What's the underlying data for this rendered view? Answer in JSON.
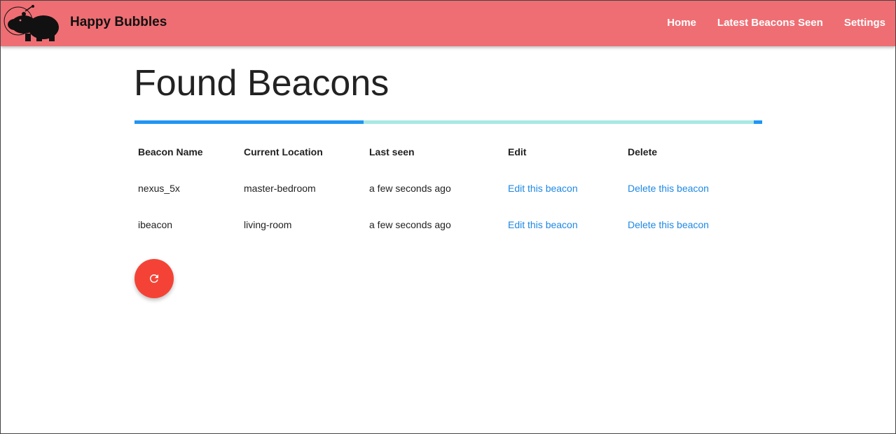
{
  "navbar": {
    "brand": "Happy Bubbles",
    "links": [
      {
        "label": "Home"
      },
      {
        "label": "Latest Beacons Seen"
      },
      {
        "label": "Settings"
      }
    ],
    "color": "#ef6e73"
  },
  "page": {
    "title": "Found Beacons"
  },
  "progress": {
    "fraction": 0.365,
    "bar_color": "#2196f3",
    "track_color": "#a7e8e4"
  },
  "table": {
    "headers": [
      "Beacon Name",
      "Current Location",
      "Last seen",
      "Edit",
      "Delete"
    ],
    "rows": [
      {
        "name": "nexus_5x",
        "location": "master-bedroom",
        "last_seen": "a few seconds ago",
        "edit": "Edit this beacon",
        "delete": "Delete this beacon"
      },
      {
        "name": "ibeacon",
        "location": "living-room",
        "last_seen": "a few seconds ago",
        "edit": "Edit this beacon",
        "delete": "Delete this beacon"
      }
    ]
  },
  "fab": {
    "icon": "refresh-icon",
    "color": "#f44336"
  },
  "logo": {
    "icon": "capybara-logo-icon"
  }
}
